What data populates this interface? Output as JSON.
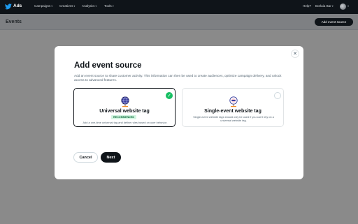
{
  "topbar": {
    "app_name": "Ads",
    "nav": [
      "Campaigns",
      "Creatives",
      "Analytics",
      "Tools"
    ],
    "help": "Help?",
    "user": "Borlaia Bar"
  },
  "page": {
    "title": "Events",
    "add_button": "Add event source"
  },
  "modal": {
    "title": "Add event source",
    "description": "Add an event source to share customer activity. This information can then be used to create audiences, optimize campaign delivery, and unlock access to advanced features.",
    "options": [
      {
        "title": "Universal website tag",
        "badge": "RECOMMENDED",
        "description": "Add a one-time universal tag and define rules based on user behavior.",
        "selected": true,
        "icon": "globe-tag-icon"
      },
      {
        "title": "Single-event website tag",
        "description": "Single-event website tags should only be used if you can't rely on a universal website tag.",
        "selected": false,
        "icon": "single-event-tag-icon"
      }
    ],
    "cancel": "Cancel",
    "next": "Next",
    "close_icon": "close-icon",
    "check_icon": "check-icon"
  },
  "colors": {
    "topbar": "#0f1419",
    "overlay": "#8a8a8a",
    "accent_green": "#17bf63",
    "twitter_blue": "#1d9bf0"
  }
}
